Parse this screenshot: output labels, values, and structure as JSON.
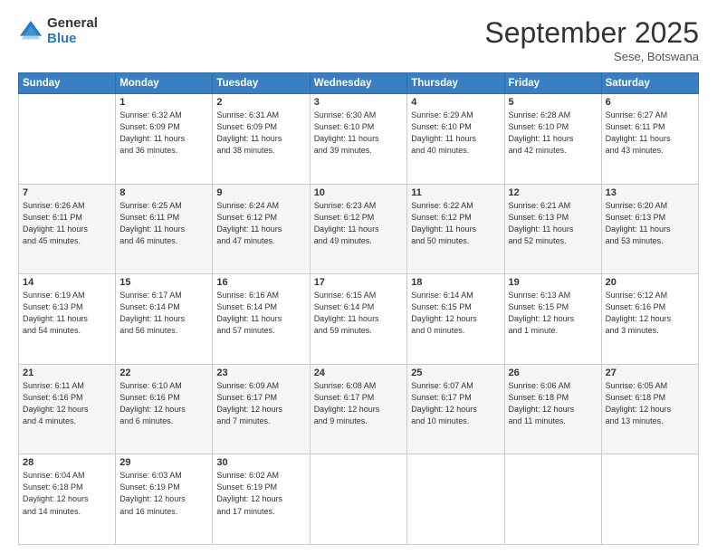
{
  "logo": {
    "general": "General",
    "blue": "Blue"
  },
  "title": "September 2025",
  "subtitle": "Sese, Botswana",
  "days_of_week": [
    "Sunday",
    "Monday",
    "Tuesday",
    "Wednesday",
    "Thursday",
    "Friday",
    "Saturday"
  ],
  "weeks": [
    [
      {
        "day": "",
        "info": ""
      },
      {
        "day": "1",
        "info": "Sunrise: 6:32 AM\nSunset: 6:09 PM\nDaylight: 11 hours\nand 36 minutes."
      },
      {
        "day": "2",
        "info": "Sunrise: 6:31 AM\nSunset: 6:09 PM\nDaylight: 11 hours\nand 38 minutes."
      },
      {
        "day": "3",
        "info": "Sunrise: 6:30 AM\nSunset: 6:10 PM\nDaylight: 11 hours\nand 39 minutes."
      },
      {
        "day": "4",
        "info": "Sunrise: 6:29 AM\nSunset: 6:10 PM\nDaylight: 11 hours\nand 40 minutes."
      },
      {
        "day": "5",
        "info": "Sunrise: 6:28 AM\nSunset: 6:10 PM\nDaylight: 11 hours\nand 42 minutes."
      },
      {
        "day": "6",
        "info": "Sunrise: 6:27 AM\nSunset: 6:11 PM\nDaylight: 11 hours\nand 43 minutes."
      }
    ],
    [
      {
        "day": "7",
        "info": "Sunrise: 6:26 AM\nSunset: 6:11 PM\nDaylight: 11 hours\nand 45 minutes."
      },
      {
        "day": "8",
        "info": "Sunrise: 6:25 AM\nSunset: 6:11 PM\nDaylight: 11 hours\nand 46 minutes."
      },
      {
        "day": "9",
        "info": "Sunrise: 6:24 AM\nSunset: 6:12 PM\nDaylight: 11 hours\nand 47 minutes."
      },
      {
        "day": "10",
        "info": "Sunrise: 6:23 AM\nSunset: 6:12 PM\nDaylight: 11 hours\nand 49 minutes."
      },
      {
        "day": "11",
        "info": "Sunrise: 6:22 AM\nSunset: 6:12 PM\nDaylight: 11 hours\nand 50 minutes."
      },
      {
        "day": "12",
        "info": "Sunrise: 6:21 AM\nSunset: 6:13 PM\nDaylight: 11 hours\nand 52 minutes."
      },
      {
        "day": "13",
        "info": "Sunrise: 6:20 AM\nSunset: 6:13 PM\nDaylight: 11 hours\nand 53 minutes."
      }
    ],
    [
      {
        "day": "14",
        "info": "Sunrise: 6:19 AM\nSunset: 6:13 PM\nDaylight: 11 hours\nand 54 minutes."
      },
      {
        "day": "15",
        "info": "Sunrise: 6:17 AM\nSunset: 6:14 PM\nDaylight: 11 hours\nand 56 minutes."
      },
      {
        "day": "16",
        "info": "Sunrise: 6:16 AM\nSunset: 6:14 PM\nDaylight: 11 hours\nand 57 minutes."
      },
      {
        "day": "17",
        "info": "Sunrise: 6:15 AM\nSunset: 6:14 PM\nDaylight: 11 hours\nand 59 minutes."
      },
      {
        "day": "18",
        "info": "Sunrise: 6:14 AM\nSunset: 6:15 PM\nDaylight: 12 hours\nand 0 minutes."
      },
      {
        "day": "19",
        "info": "Sunrise: 6:13 AM\nSunset: 6:15 PM\nDaylight: 12 hours\nand 1 minute."
      },
      {
        "day": "20",
        "info": "Sunrise: 6:12 AM\nSunset: 6:16 PM\nDaylight: 12 hours\nand 3 minutes."
      }
    ],
    [
      {
        "day": "21",
        "info": "Sunrise: 6:11 AM\nSunset: 6:16 PM\nDaylight: 12 hours\nand 4 minutes."
      },
      {
        "day": "22",
        "info": "Sunrise: 6:10 AM\nSunset: 6:16 PM\nDaylight: 12 hours\nand 6 minutes."
      },
      {
        "day": "23",
        "info": "Sunrise: 6:09 AM\nSunset: 6:17 PM\nDaylight: 12 hours\nand 7 minutes."
      },
      {
        "day": "24",
        "info": "Sunrise: 6:08 AM\nSunset: 6:17 PM\nDaylight: 12 hours\nand 9 minutes."
      },
      {
        "day": "25",
        "info": "Sunrise: 6:07 AM\nSunset: 6:17 PM\nDaylight: 12 hours\nand 10 minutes."
      },
      {
        "day": "26",
        "info": "Sunrise: 6:06 AM\nSunset: 6:18 PM\nDaylight: 12 hours\nand 11 minutes."
      },
      {
        "day": "27",
        "info": "Sunrise: 6:05 AM\nSunset: 6:18 PM\nDaylight: 12 hours\nand 13 minutes."
      }
    ],
    [
      {
        "day": "28",
        "info": "Sunrise: 6:04 AM\nSunset: 6:18 PM\nDaylight: 12 hours\nand 14 minutes."
      },
      {
        "day": "29",
        "info": "Sunrise: 6:03 AM\nSunset: 6:19 PM\nDaylight: 12 hours\nand 16 minutes."
      },
      {
        "day": "30",
        "info": "Sunrise: 6:02 AM\nSunset: 6:19 PM\nDaylight: 12 hours\nand 17 minutes."
      },
      {
        "day": "",
        "info": ""
      },
      {
        "day": "",
        "info": ""
      },
      {
        "day": "",
        "info": ""
      },
      {
        "day": "",
        "info": ""
      }
    ]
  ]
}
